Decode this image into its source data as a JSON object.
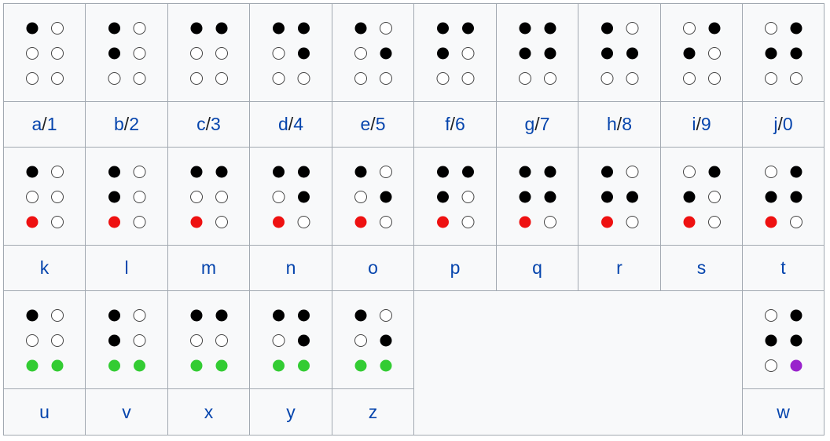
{
  "colors": {
    "raised": "#000000",
    "added_dot_3": "#ee1111",
    "added_dots_3_6": "#33cc33",
    "special_dot_6": "#9922cc",
    "link": "#0645ad"
  },
  "rows": [
    {
      "cells": [
        {
          "dots": [
            1
          ],
          "labels": [
            "a",
            "1"
          ]
        },
        {
          "dots": [
            1,
            2
          ],
          "labels": [
            "b",
            "2"
          ]
        },
        {
          "dots": [
            1,
            4
          ],
          "labels": [
            "c",
            "3"
          ]
        },
        {
          "dots": [
            1,
            4,
            5
          ],
          "labels": [
            "d",
            "4"
          ]
        },
        {
          "dots": [
            1,
            5
          ],
          "labels": [
            "e",
            "5"
          ]
        },
        {
          "dots": [
            1,
            2,
            4
          ],
          "labels": [
            "f",
            "6"
          ]
        },
        {
          "dots": [
            1,
            2,
            4,
            5
          ],
          "labels": [
            "g",
            "7"
          ]
        },
        {
          "dots": [
            1,
            2,
            5
          ],
          "labels": [
            "h",
            "8"
          ]
        },
        {
          "dots": [
            2,
            4
          ],
          "labels": [
            "i",
            "9"
          ]
        },
        {
          "dots": [
            2,
            4,
            5
          ],
          "labels": [
            "j",
            "0"
          ]
        }
      ]
    },
    {
      "cells": [
        {
          "dots": [
            1
          ],
          "red": [
            3
          ],
          "labels": [
            "k"
          ]
        },
        {
          "dots": [
            1,
            2
          ],
          "red": [
            3
          ],
          "labels": [
            "l"
          ]
        },
        {
          "dots": [
            1,
            4
          ],
          "red": [
            3
          ],
          "labels": [
            "m"
          ]
        },
        {
          "dots": [
            1,
            4,
            5
          ],
          "red": [
            3
          ],
          "labels": [
            "n"
          ]
        },
        {
          "dots": [
            1,
            5
          ],
          "red": [
            3
          ],
          "labels": [
            "o"
          ]
        },
        {
          "dots": [
            1,
            2,
            4
          ],
          "red": [
            3
          ],
          "labels": [
            "p"
          ]
        },
        {
          "dots": [
            1,
            2,
            4,
            5
          ],
          "red": [
            3
          ],
          "labels": [
            "q"
          ]
        },
        {
          "dots": [
            1,
            2,
            5
          ],
          "red": [
            3
          ],
          "labels": [
            "r"
          ]
        },
        {
          "dots": [
            2,
            4
          ],
          "red": [
            3
          ],
          "labels": [
            "s"
          ]
        },
        {
          "dots": [
            2,
            4,
            5
          ],
          "red": [
            3
          ],
          "labels": [
            "t"
          ]
        }
      ]
    },
    {
      "cells": [
        {
          "dots": [
            1
          ],
          "green": [
            3,
            6
          ],
          "labels": [
            "u"
          ]
        },
        {
          "dots": [
            1,
            2
          ],
          "green": [
            3,
            6
          ],
          "labels": [
            "v"
          ]
        },
        {
          "dots": [
            1,
            4
          ],
          "green": [
            3,
            6
          ],
          "labels": [
            "x"
          ]
        },
        {
          "dots": [
            1,
            4,
            5
          ],
          "green": [
            3,
            6
          ],
          "labels": [
            "y"
          ]
        },
        {
          "dots": [
            1,
            5
          ],
          "green": [
            3,
            6
          ],
          "labels": [
            "z"
          ]
        },
        null,
        null,
        null,
        null,
        {
          "dots": [
            2,
            4,
            5
          ],
          "purple": [
            6
          ],
          "labels": [
            "w"
          ]
        }
      ]
    }
  ],
  "separator": "/"
}
